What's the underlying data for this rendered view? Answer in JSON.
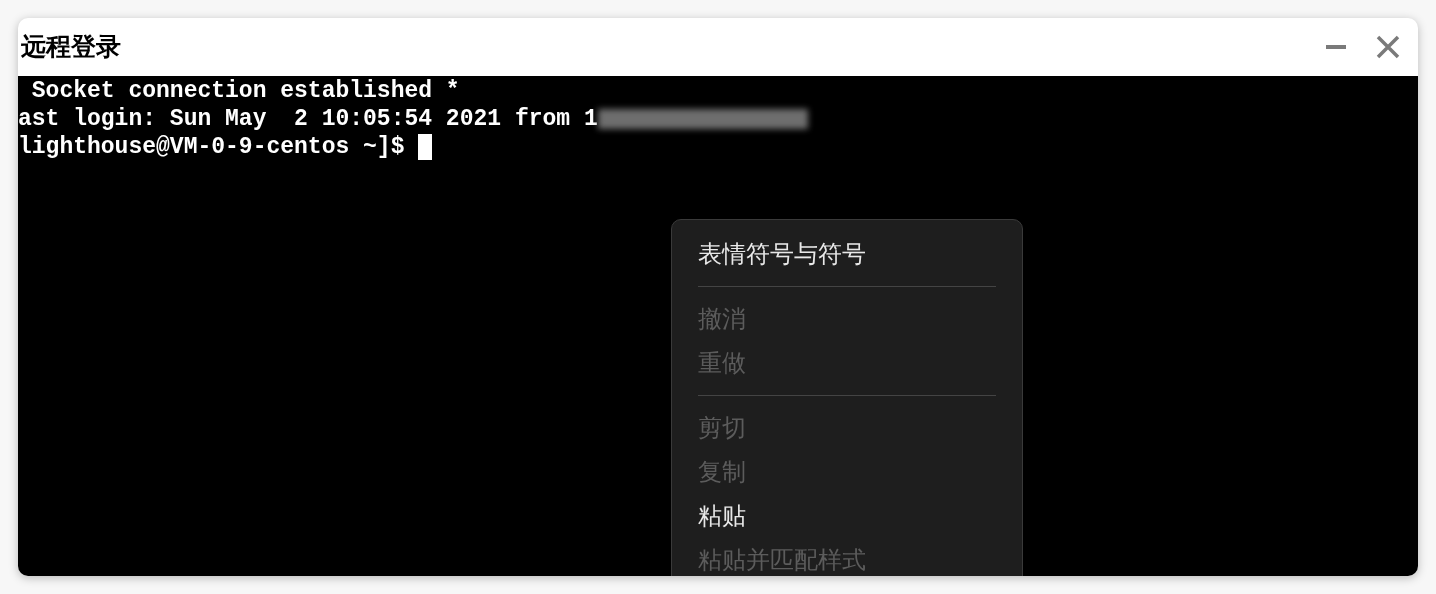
{
  "window": {
    "title": "远程登录"
  },
  "terminal": {
    "lines": [
      {
        "text": " Socket connection established *",
        "redacted": false
      },
      {
        "text": "ast login: Sun May  2 10:05:54 2021 from 1",
        "redacted": true
      },
      {
        "text": "lighthouse@VM-0-9-centos ~]$ ",
        "redacted": false
      }
    ],
    "cursor": true
  },
  "context_menu": {
    "items": [
      {
        "kind": "item",
        "label": "表情符号与符号",
        "disabled": false
      },
      {
        "kind": "separator"
      },
      {
        "kind": "item",
        "label": "撤消",
        "disabled": true
      },
      {
        "kind": "item",
        "label": "重做",
        "disabled": true
      },
      {
        "kind": "separator"
      },
      {
        "kind": "item",
        "label": "剪切",
        "disabled": true
      },
      {
        "kind": "item",
        "label": "复制",
        "disabled": true
      },
      {
        "kind": "item",
        "label": "粘贴",
        "disabled": false
      },
      {
        "kind": "item",
        "label": "粘贴并匹配样式",
        "disabled": true
      }
    ]
  }
}
